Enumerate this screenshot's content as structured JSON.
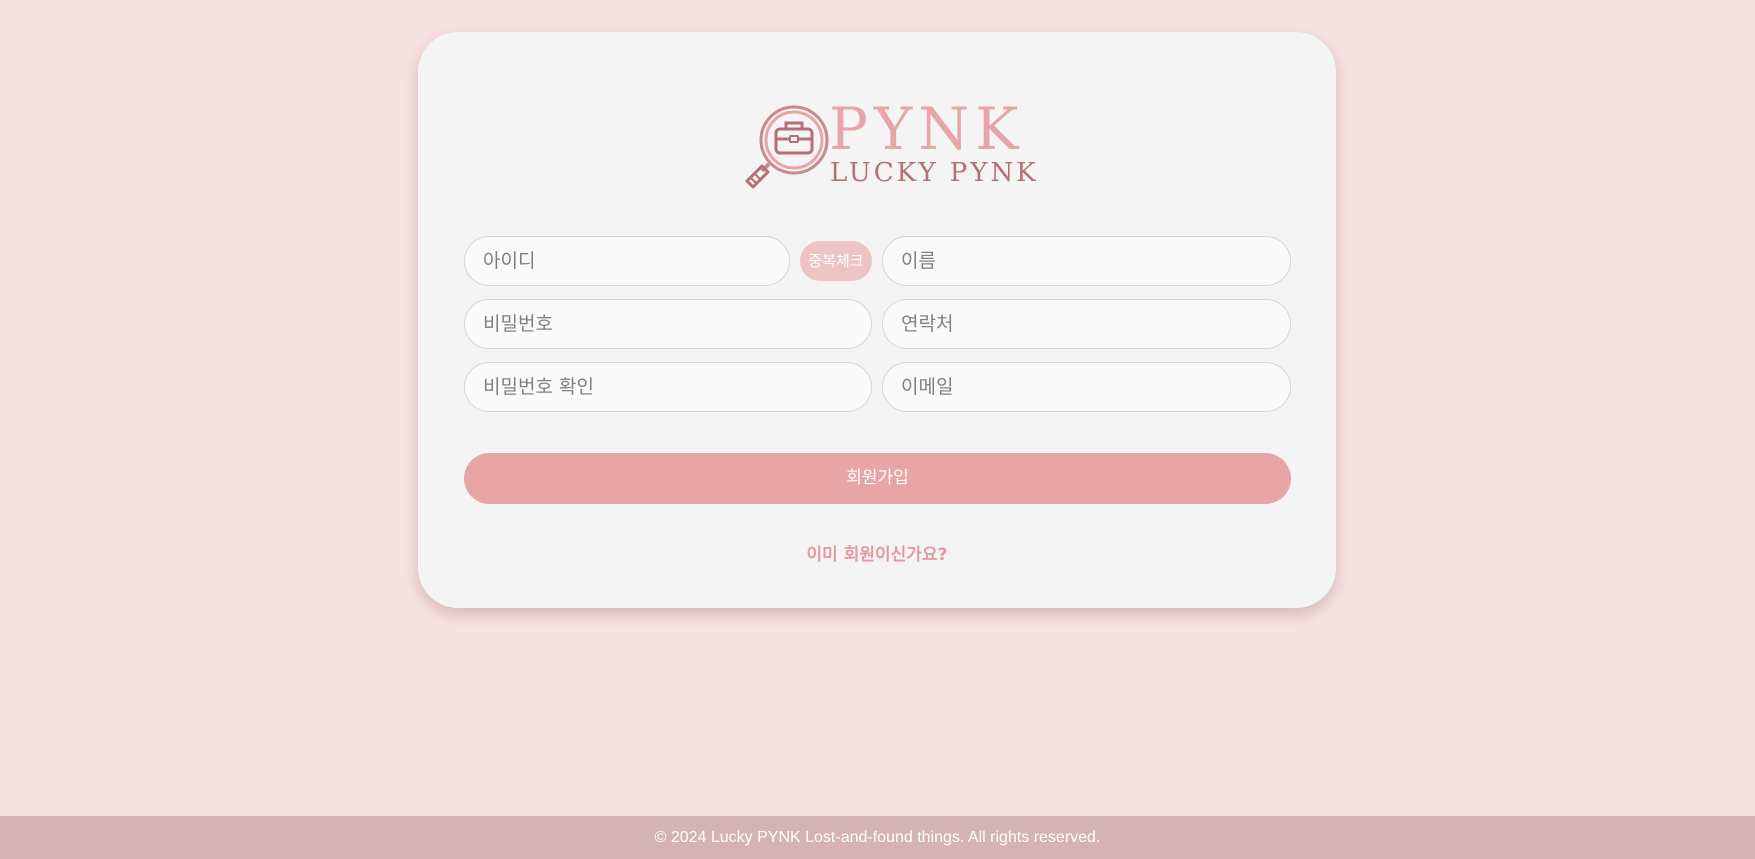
{
  "logo": {
    "title": "PYNK",
    "subtitle": "LUCKY PYNK",
    "icon": "magnifier-briefcase-icon"
  },
  "form": {
    "id_placeholder": "아이디",
    "dup_check_label": "중복체크",
    "name_placeholder": "이름",
    "password_placeholder": "비밀번호",
    "phone_placeholder": "연락처",
    "password_confirm_placeholder": "비밀번호 확인",
    "email_placeholder": "이메일",
    "signup_label": "회원가입",
    "login_link": "이미 회원이신가요?"
  },
  "footer": {
    "text": "© 2024 Lucky PYNK Lost-and-found things. All rights reserved."
  },
  "colors": {
    "background": "#f6e1e2",
    "card": "#f4f4f4",
    "accent": "#e7a5a6",
    "dup_button": "#eec3c4",
    "link": "#e49b9e",
    "footer": "#d5b2b5"
  }
}
